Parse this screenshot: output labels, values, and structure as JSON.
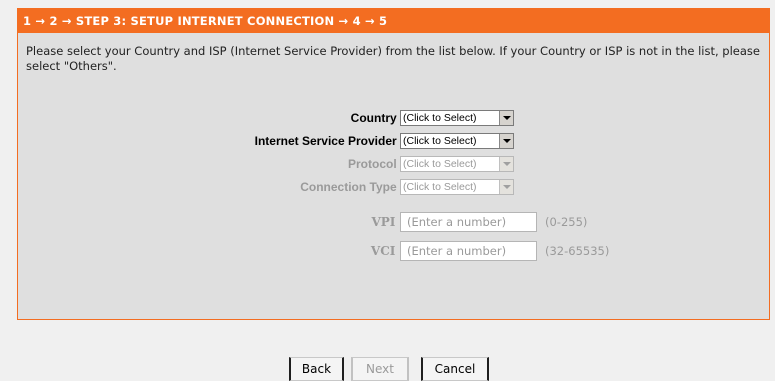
{
  "header": {
    "title": "1 → 2 → STEP 3: SETUP INTERNET CONNECTION → 4 → 5"
  },
  "description": "Please select your Country and ISP (Internet Service Provider) from the list below. If your Country or ISP is not in the list, please select \"Others\".",
  "form": {
    "country": {
      "label": "Country :",
      "value": "(Click to Select)"
    },
    "isp": {
      "label": "Internet Service Provider :",
      "value": "(Click to Select)"
    },
    "protocol": {
      "label": "Protocol :",
      "value": "(Click to Select)"
    },
    "connection_type": {
      "label": "Connection Type :",
      "value": "(Click to Select)"
    },
    "vpi": {
      "label": "VPI :",
      "placeholder": "(Enter a number)",
      "range": "(0-255)"
    },
    "vci": {
      "label": "VCI :",
      "placeholder": "(Enter a number)",
      "range": "(32-65535)"
    }
  },
  "buttons": {
    "back": "Back",
    "next": "Next",
    "cancel": "Cancel"
  },
  "colors": {
    "accent": "#f36d21",
    "panel_bg": "#dfdfdf",
    "disabled_text": "#9a9a9a"
  }
}
